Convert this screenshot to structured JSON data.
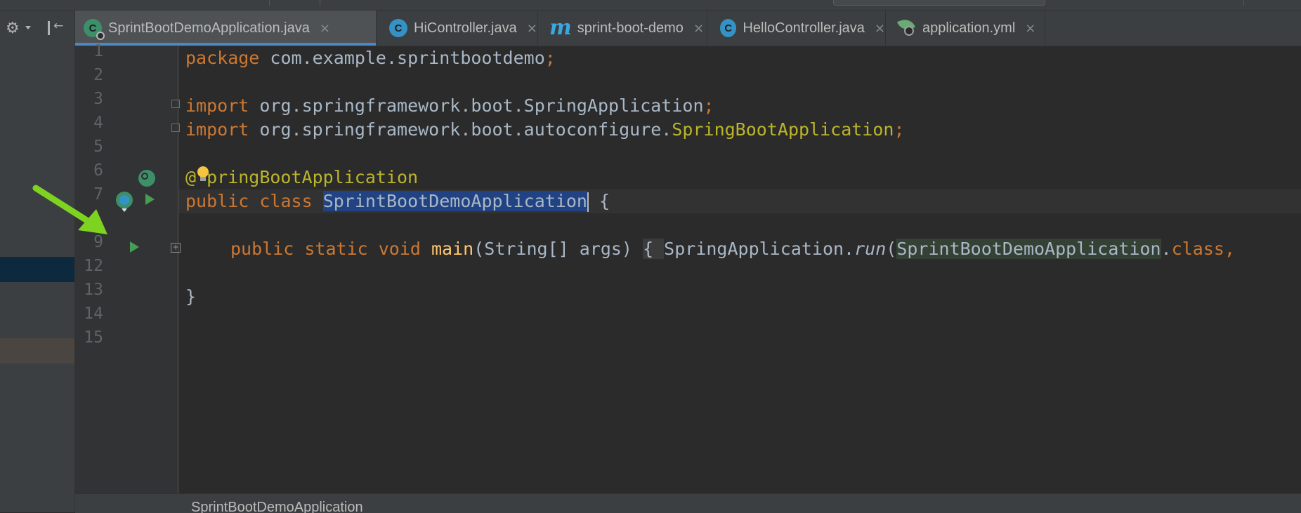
{
  "tabs": [
    {
      "label": "SprintBootDemoApplication.java",
      "icon": "spring-class-icon",
      "active": true
    },
    {
      "label": "HiController.java",
      "icon": "class-icon"
    },
    {
      "label": "sprint-boot-demo",
      "icon": "maven-icon"
    },
    {
      "label": "HelloController.java",
      "icon": "class-icon"
    },
    {
      "label": "application.yml",
      "icon": "spring-leaf-icon"
    }
  ],
  "icon_glyphs": {
    "class": "C",
    "maven": "m",
    "close": "×",
    "gear": "⚙",
    "collapse": "←"
  },
  "line_numbers": [
    "1",
    "2",
    "3",
    "4",
    "5",
    "6",
    "7",
    "9",
    "12",
    "13",
    "14",
    "15"
  ],
  "code": {
    "l1": {
      "kw": "package",
      "rest": " com.example.sprintbootdemo",
      "semi": ";"
    },
    "l3": {
      "kw": "import",
      "pkg": " org.springframework.boot.SpringApplication",
      "semi": ";"
    },
    "l4": {
      "kw": "import",
      "pkg": " org.springframework.boot.autoconfigure.",
      "cls": "SpringBootApplication",
      "semi": ";"
    },
    "l6": {
      "at": "@",
      "ann": "pringBootApplication"
    },
    "l7": {
      "kw": "public class",
      "space": " ",
      "name": "SprintBootDemoApplication",
      "brace": " {"
    },
    "l9": {
      "kw": "public static void",
      "space": " ",
      "fn": "main",
      "params": "(String[] args)",
      "space2": " ",
      "fold": "{ ",
      "cls": "SpringApplication.",
      "run": "run",
      "paren": "(",
      "arg": "SprintBootDemoApplication",
      "dot": ".",
      "kw2": "class",
      "comma": ","
    },
    "l13": "}"
  },
  "status": {
    "breadcrumb": "SprintBootDemoApplication"
  },
  "colors": {
    "keyword": "#cc7832",
    "annotation": "#bbb529",
    "method": "#ffc66d",
    "selection": "#214283",
    "run": "#499c54",
    "pointer_arrow": "#7ed321"
  }
}
